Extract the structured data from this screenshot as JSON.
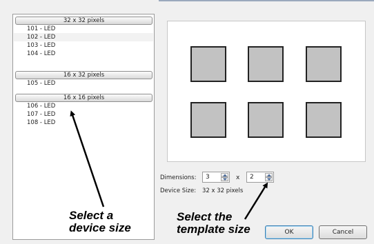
{
  "device_list": {
    "groups": [
      {
        "header": "32 x 32 pixels",
        "items": [
          {
            "label": "101 - LED",
            "selected": false
          },
          {
            "label": "102 - LED",
            "selected": true
          },
          {
            "label": "103 - LED",
            "selected": false
          },
          {
            "label": "104 - LED",
            "selected": false
          }
        ]
      },
      {
        "header": "16 x 32 pixels",
        "items": [
          {
            "label": "105 - LED",
            "selected": false
          }
        ]
      },
      {
        "header": "16 x 16 pixels",
        "items": [
          {
            "label": "106 - LED",
            "selected": false
          },
          {
            "label": "107 - LED",
            "selected": false
          },
          {
            "label": "108 - LED",
            "selected": false
          }
        ]
      }
    ]
  },
  "dimensions": {
    "label": "Dimensions:",
    "columns": "3",
    "separator": "x",
    "rows": "2"
  },
  "device_size": {
    "label": "Device Size:",
    "value": "32 x 32 pixels"
  },
  "buttons": {
    "ok": "OK",
    "cancel": "Cancel"
  },
  "annotations": {
    "device_size_callout": [
      "Select a",
      "device size"
    ],
    "template_size_callout": [
      "Select the",
      "template size"
    ]
  },
  "colors": {
    "dialog_background": "#f0f0f0",
    "tile_fill": "#c2c2c2",
    "tile_border": "#222222",
    "selected_row": "#f2f2f2",
    "default_button_border": "#3c7fb1"
  }
}
